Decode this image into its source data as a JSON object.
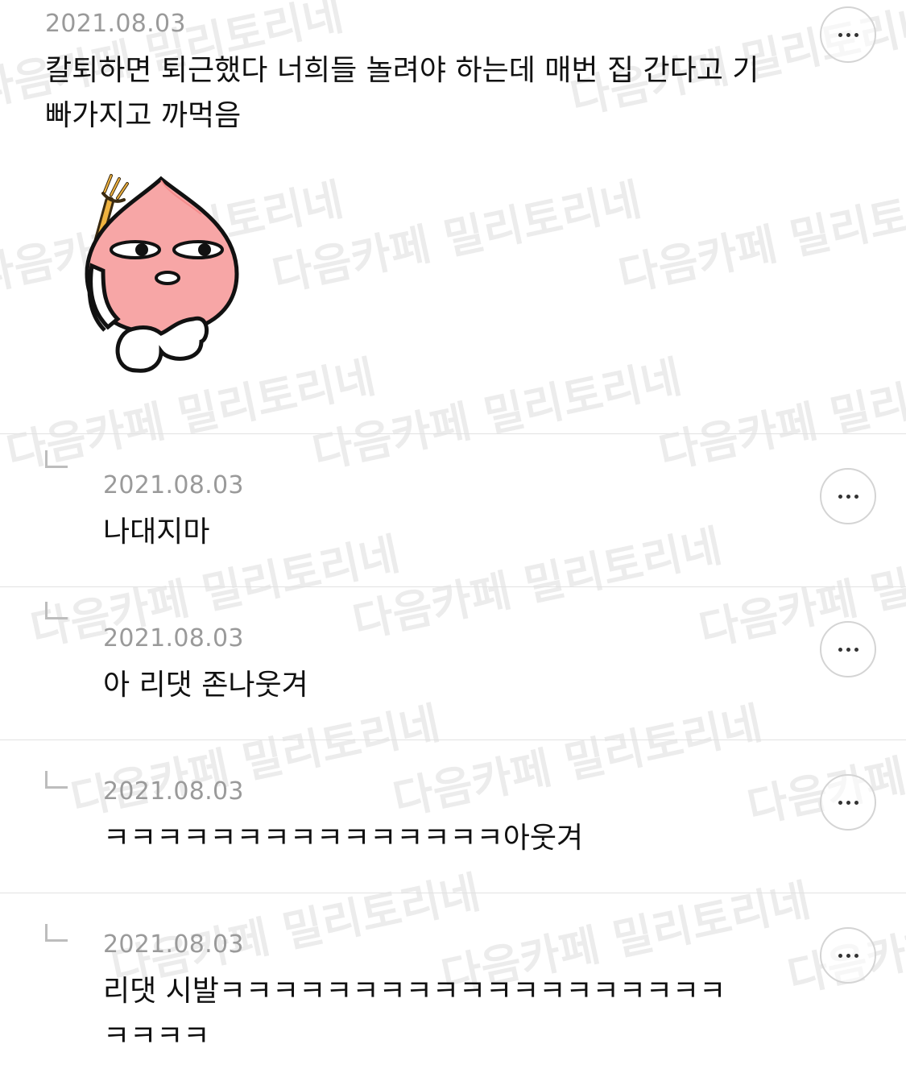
{
  "watermark_text": "다음카페 밀리토리네",
  "comments": [
    {
      "date": "2021.08.03",
      "text_line1": "칼퇴하면 퇴근했다 너희들 놀려야 하는데 매번 집 간다고 기",
      "text_line2": "빠가지고 까먹음",
      "has_sticker": true,
      "sticker": "peach-character-emoticon",
      "more_icon": "more-dots-icon"
    },
    {
      "date": "2021.08.03",
      "text_line1": "나대지마",
      "reply_icon": "reply-arrow-icon",
      "more_icon": "more-dots-icon"
    },
    {
      "date": "2021.08.03",
      "text_line1": "아 리댓 존나웃겨",
      "reply_icon": "reply-arrow-icon",
      "more_icon": "more-dots-icon"
    },
    {
      "date": "2021.08.03",
      "text_line1": "ㅋㅋㅋㅋㅋㅋㅋㅋㅋㅋㅋㅋㅋㅋㅋ아웃겨",
      "reply_icon": "reply-arrow-icon",
      "more_icon": "more-dots-icon"
    },
    {
      "date": "2021.08.03",
      "text_line1": "리댓 시발ㅋㅋㅋㅋㅋㅋㅋㅋㅋㅋㅋㅋㅋㅋㅋㅋㅋㅋㅋ",
      "text_line2": "ㅋㅋㅋㅋ",
      "reply_icon": "reply-arrow-icon",
      "more_icon": "more-dots-icon"
    }
  ],
  "colors": {
    "background": "#ffffff",
    "date_text": "#9a9a9a",
    "body_text": "#111111",
    "divider": "#e2e2e2",
    "sticker_peach": "#f7a6a6"
  }
}
